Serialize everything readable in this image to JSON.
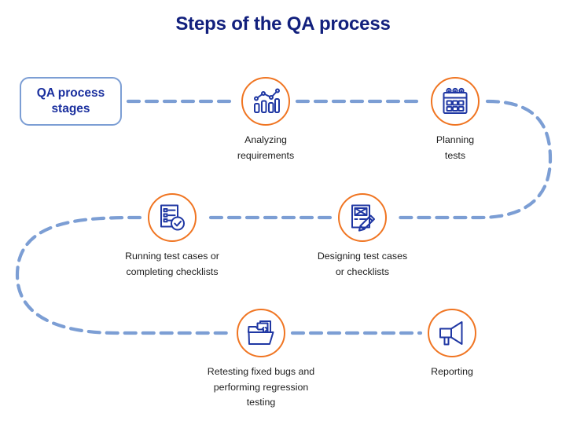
{
  "page": {
    "title": "Steps of the QA process",
    "background_color": "#ffffff"
  },
  "colors": {
    "title": "#12207d",
    "icon_stroke": "#1f37a3",
    "ring": "#f07522",
    "connector": "#7c9ed4",
    "box_border": "#7c9ed4",
    "box_label": "#1a2f9e",
    "caption": "#1d1d1d"
  },
  "start_box": {
    "label": "QA process\nstages"
  },
  "steps": [
    {
      "index": 1,
      "icon": "bar-chart-trend-icon",
      "caption": "Analyzing\nrequirements"
    },
    {
      "index": 2,
      "icon": "calendar-icon",
      "caption": "Planning\ntests"
    },
    {
      "index": 3,
      "icon": "document-checkmark-icon",
      "caption": "Designing test cases\nor checklists"
    },
    {
      "index": 4,
      "icon": "checklist-verified-icon",
      "caption": "Running test cases or\ncompleting checklists"
    },
    {
      "index": 5,
      "icon": "folder-code-files-icon",
      "caption": "Retesting fixed bugs and\nperforming regression testing"
    },
    {
      "index": 6,
      "icon": "megaphone-icon",
      "caption": "Reporting"
    }
  ],
  "flow": {
    "order": [
      "QA process stages",
      "Analyzing requirements",
      "Planning tests",
      "Designing test cases or checklists",
      "Running test cases or completing checklists",
      "Retesting fixed bugs and performing regression testing",
      "Reporting"
    ],
    "connector_style": "dashed"
  }
}
